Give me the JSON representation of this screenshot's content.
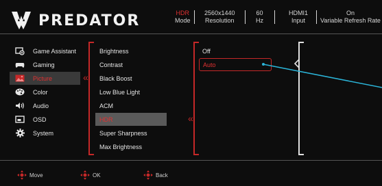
{
  "brand": {
    "name": "PREDATOR"
  },
  "status": [
    {
      "value": "HDR",
      "label": "Mode",
      "highlight": true
    },
    {
      "value": "2560x1440",
      "label": "Resolution",
      "highlight": false
    },
    {
      "value": "60",
      "label": "Hz",
      "highlight": false
    },
    {
      "value": "HDMI1",
      "label": "Input",
      "highlight": false
    },
    {
      "value": "On",
      "label": "Variable Refresh Rate",
      "highlight": false
    }
  ],
  "menu": [
    {
      "label": "Game Assistant",
      "icon": "game-assistant-icon"
    },
    {
      "label": "Gaming",
      "icon": "gamepad-icon"
    },
    {
      "label": "Picture",
      "icon": "picture-icon",
      "selected": true
    },
    {
      "label": "Color",
      "icon": "palette-icon"
    },
    {
      "label": "Audio",
      "icon": "speaker-icon"
    },
    {
      "label": "OSD",
      "icon": "osd-icon"
    },
    {
      "label": "System",
      "icon": "gear-icon"
    }
  ],
  "submenu": [
    {
      "label": "Brightness"
    },
    {
      "label": "Contrast"
    },
    {
      "label": "Black Boost"
    },
    {
      "label": "Low Blue Light"
    },
    {
      "label": "ACM"
    },
    {
      "label": "HDR",
      "selected": true
    },
    {
      "label": "Super Sharpness"
    },
    {
      "label": "Max Brightness"
    }
  ],
  "options": [
    {
      "label": "Off"
    },
    {
      "label": "Auto",
      "selected": true
    }
  ],
  "footer": [
    {
      "label": "Move",
      "icon": "dpad-icon"
    },
    {
      "label": "OK",
      "icon": "dpad-icon"
    },
    {
      "label": "Back",
      "icon": "dpad-icon"
    }
  ],
  "colors": {
    "accent": "#c62828",
    "background": "#0d0d0d",
    "highlight_text": "#e03131",
    "pointer": "#2bb5d9"
  }
}
